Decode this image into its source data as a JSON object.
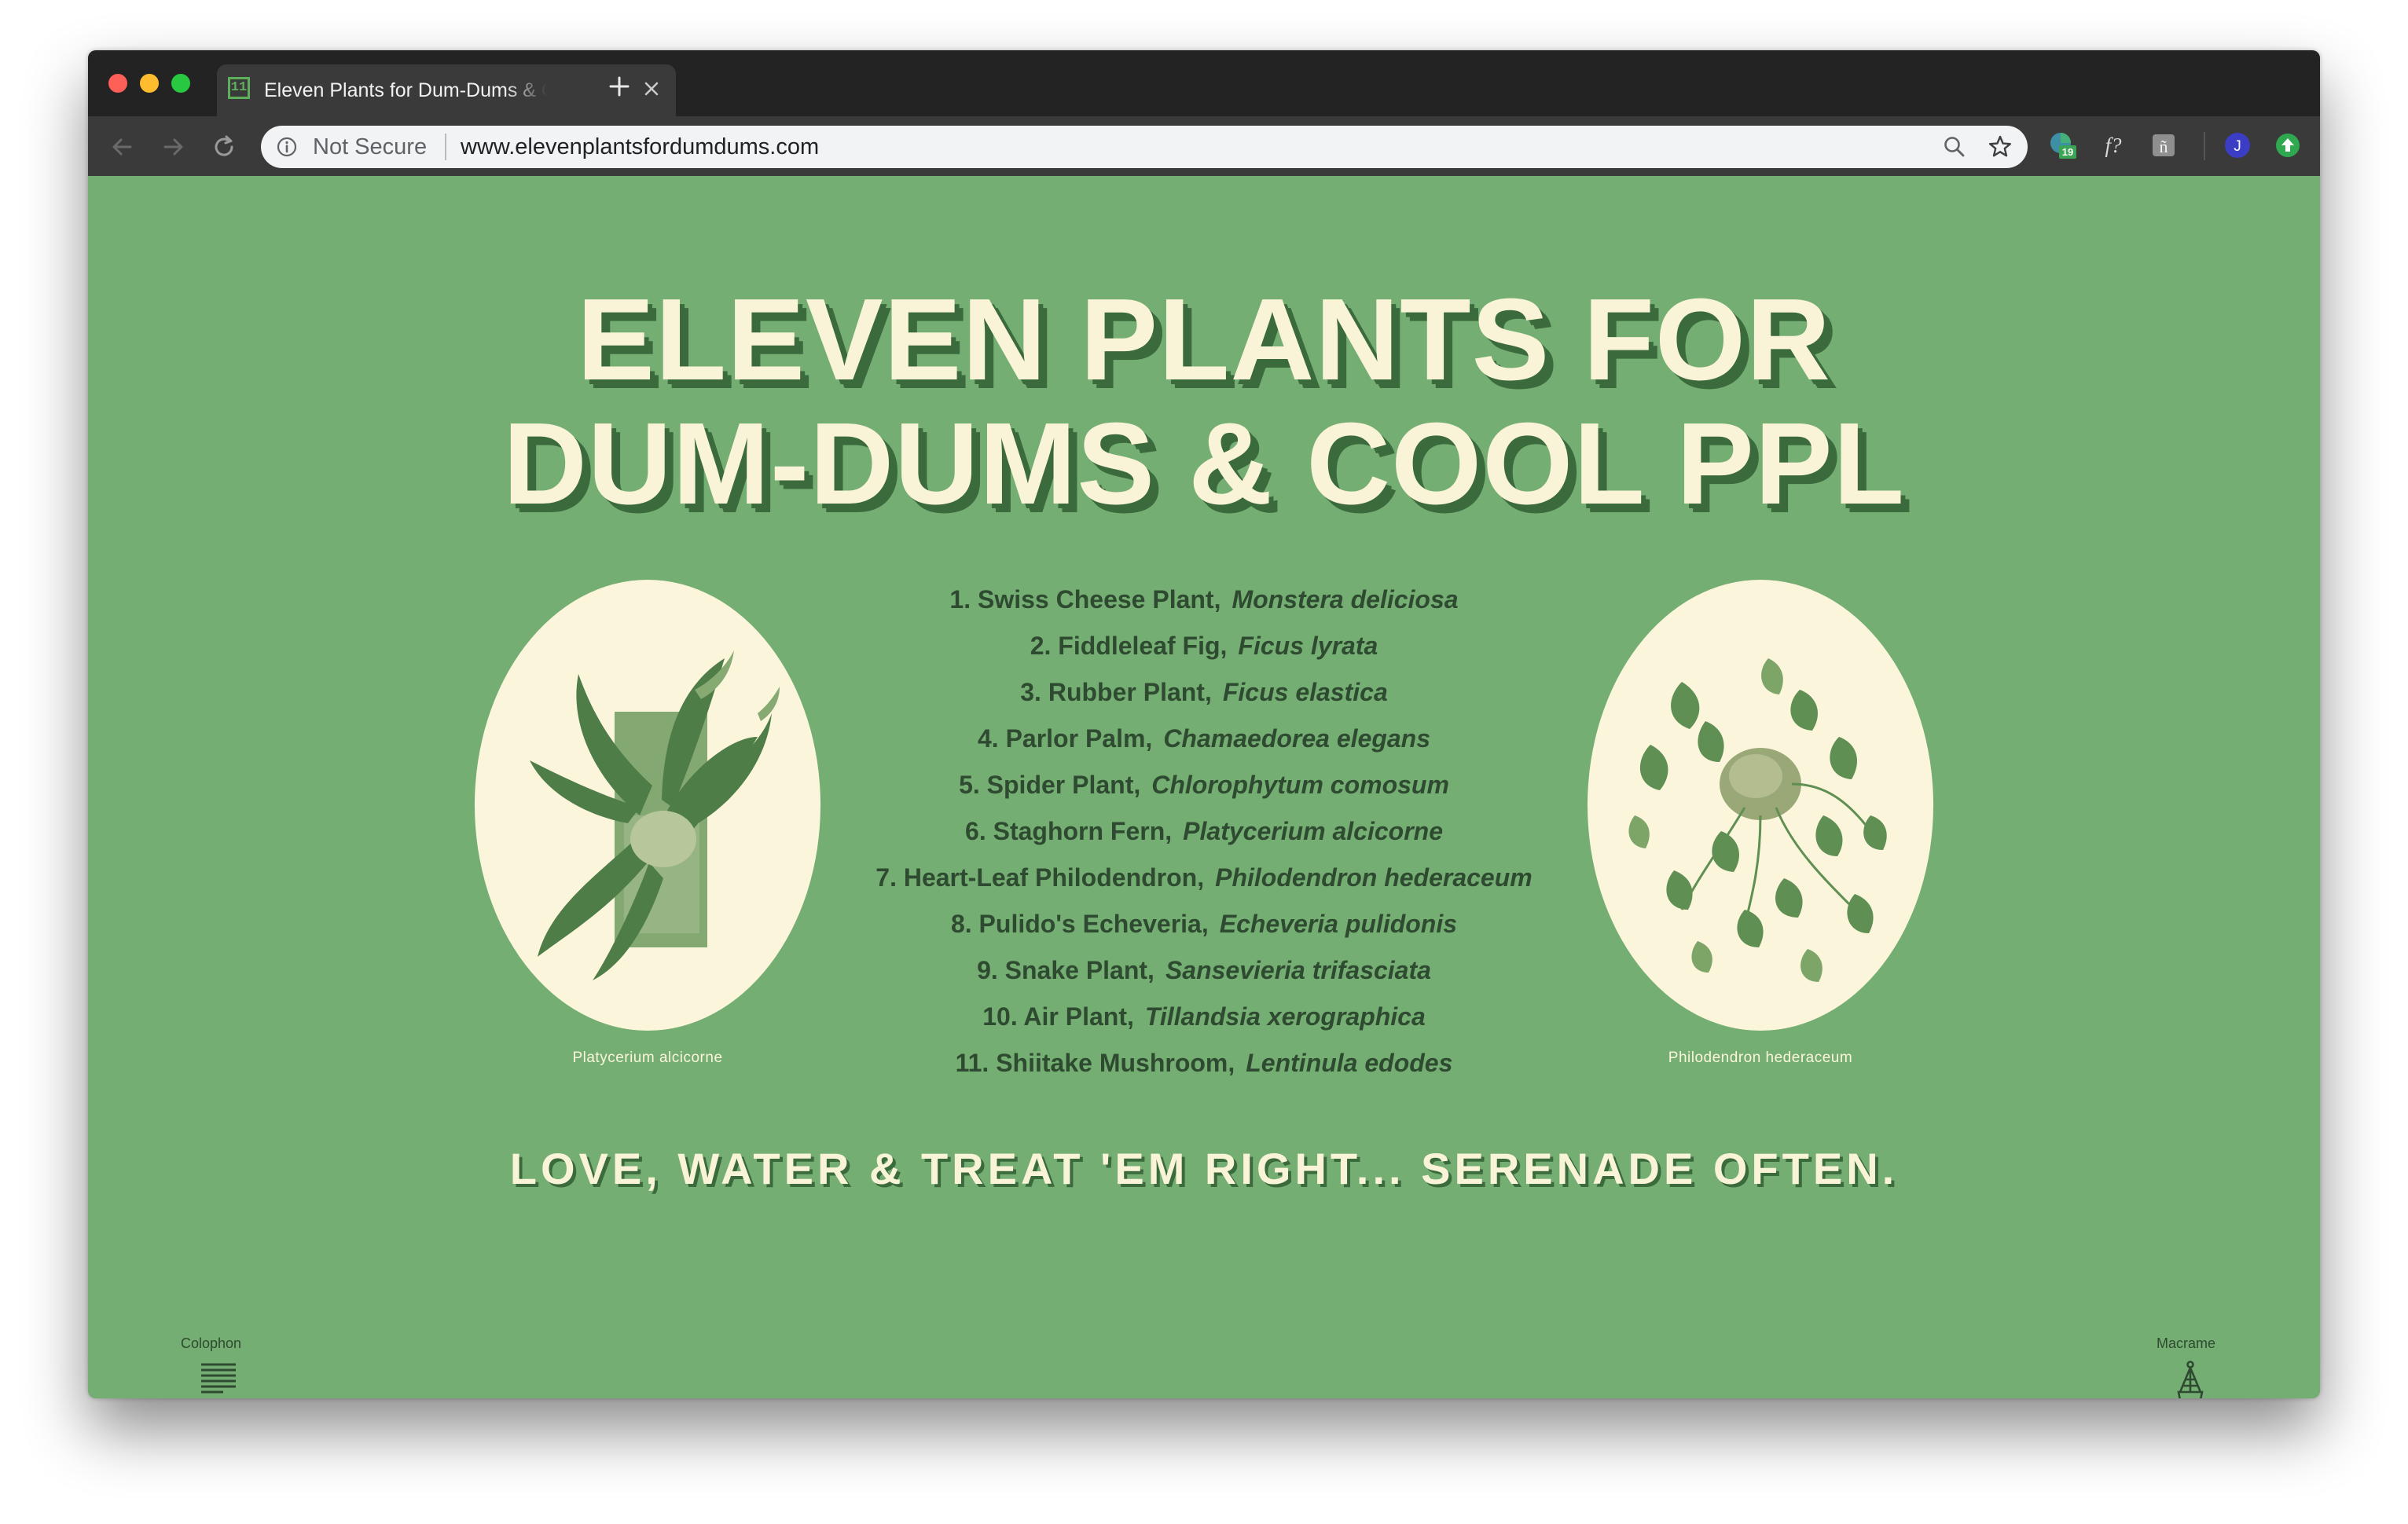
{
  "browser": {
    "tab_title": "Eleven Plants for Dum-Dums & Cool PPL",
    "tab_favicon_text": "11",
    "security_label": "Not Secure",
    "url": "www.elevenplantsfordumdums.com",
    "extension_badge": "19",
    "profile_initial": "J",
    "extension_font_glyph": "f?",
    "extension_grey_glyph": "ñ"
  },
  "page": {
    "title_line1": "ELEVEN PLANTS FOR",
    "title_line2": "DUM-DUMS & COOL PPL",
    "plants": [
      {
        "common": "1. Swiss Cheese Plant,",
        "latin": "Monstera deliciosa"
      },
      {
        "common": "2. Fiddleleaf Fig,",
        "latin": "Ficus lyrata"
      },
      {
        "common": "3. Rubber Plant,",
        "latin": "Ficus elastica"
      },
      {
        "common": "4. Parlor Palm,",
        "latin": "Chamaedorea elegans"
      },
      {
        "common": "5. Spider Plant,",
        "latin": "Chlorophytum comosum"
      },
      {
        "common": "6. Staghorn Fern,",
        "latin": "Platycerium alcicorne"
      },
      {
        "common": "7. Heart-Leaf Philodendron,",
        "latin": "Philodendron hederaceum"
      },
      {
        "common": "8. Pulido's Echeveria,",
        "latin": "Echeveria pulidonis"
      },
      {
        "common": "9. Snake Plant,",
        "latin": "Sansevieria trifasciata"
      },
      {
        "common": "10. Air Plant,",
        "latin": "Tillandsia xerographica"
      },
      {
        "common": "11. Shiitake Mushroom,",
        "latin": "Lentinula edodes"
      }
    ],
    "left_caption": "Platycerium alcicorne",
    "right_caption": "Philodendron hederaceum",
    "tagline": "LOVE, WATER & TREAT 'EM RIGHT... SERENADE OFTEN.",
    "colophon_label": "Colophon",
    "macrame_label": "Macrame"
  },
  "colors": {
    "page_background": "#75ae72",
    "title_cream": "#f9f3d7",
    "title_shadow": "#3b6b3d",
    "list_text": "#2e4a30",
    "portrait_background": "#fbf5dc",
    "browser_chrome": "#232324",
    "toolbar": "#3a3a3b"
  },
  "icons": {
    "tab_close": "close-icon",
    "new_tab": "plus-icon",
    "back": "back-arrow-icon",
    "forward": "forward-arrow-icon",
    "reload": "reload-icon",
    "info": "info-icon",
    "zoom": "magnifier-icon",
    "bookmark": "star-icon",
    "colophon": "text-lines-icon",
    "macrame": "hanging-planter-icon"
  }
}
